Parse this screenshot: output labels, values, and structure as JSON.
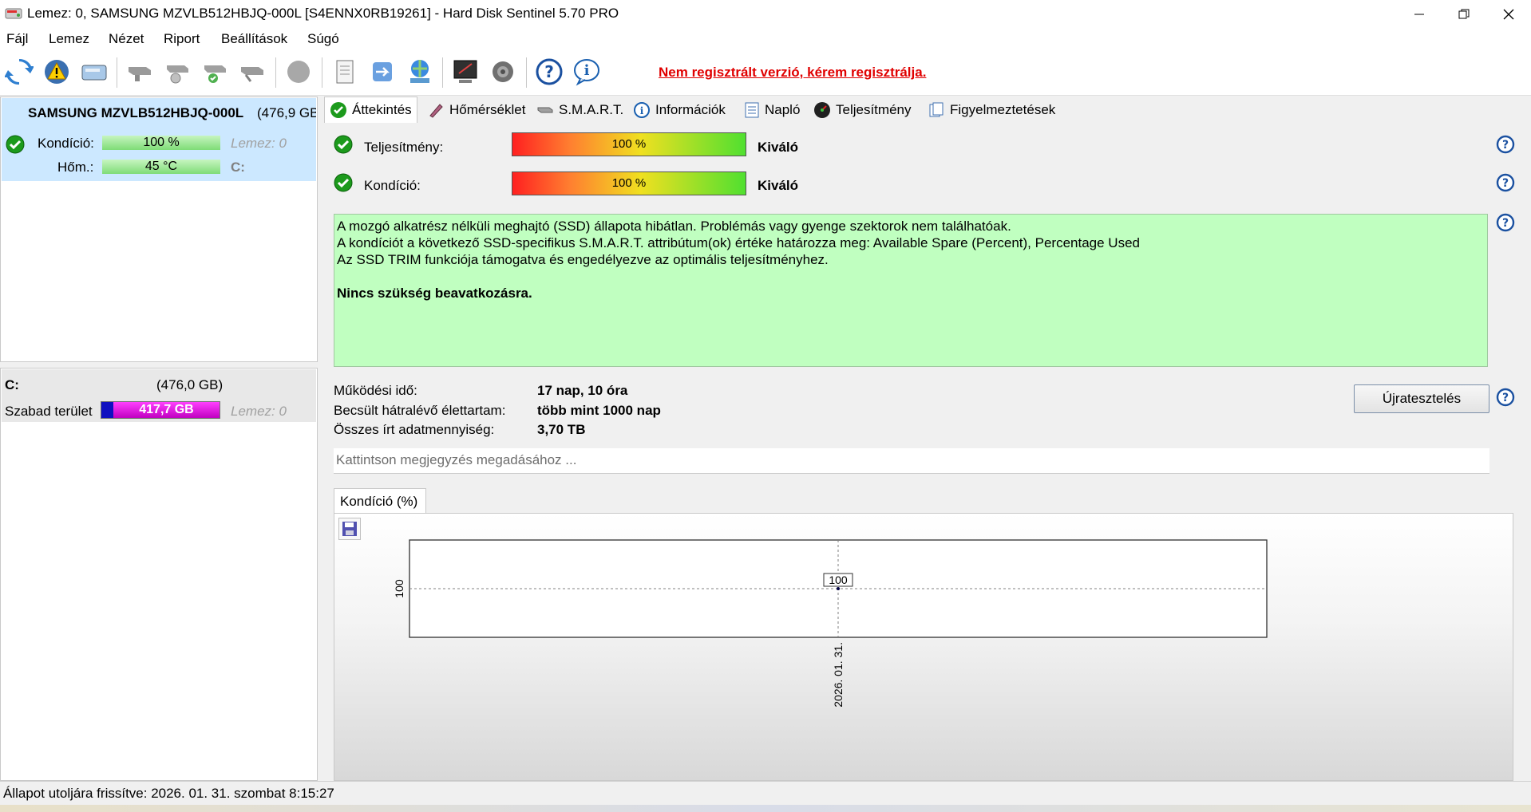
{
  "window": {
    "title": "Lemez: 0, SAMSUNG MZVLB512HBJQ-000L [S4ENNX0RB19261]  -  Hard Disk Sentinel 5.70 PRO"
  },
  "menu": [
    "Fájl",
    "Lemez",
    "Nézet",
    "Riport",
    "Beállítások",
    "Súgó"
  ],
  "toolbar": {
    "register_message": "Nem regisztrált verzió, kérem regisztrálja."
  },
  "disk": {
    "name": "SAMSUNG MZVLB512HBJQ-000L",
    "size": "(476,9 GB",
    "condition_label": "Kondíció:",
    "condition_value": "100 %",
    "condition_fraction": 1.0,
    "disk_label": "Lemez: 0",
    "temp_label": "Hőm.:",
    "temp_value": "45 °C",
    "temp_fraction": 1.0,
    "drive_letter": "C:"
  },
  "volume": {
    "letter": "C:",
    "size": "(476,0 GB)",
    "free_label": "Szabad terület",
    "free_value": "417,7 GB",
    "disk_label": "Lemez: 0"
  },
  "tabs": [
    "Áttekintés",
    "Hőmérséklet",
    "S.M.A.R.T.",
    "Információk",
    "Napló",
    "Teljesítmény",
    "Figyelmeztetések"
  ],
  "overview": {
    "performance_label": "Teljesítmény:",
    "performance_value": "100 %",
    "performance_fraction": 1.0,
    "performance_rating": "Kiváló",
    "condition_label": "Kondíció:",
    "condition_value": "100 %",
    "condition_fraction": 1.0,
    "condition_rating": "Kiváló",
    "description": [
      "A mozgó alkatrész nélküli meghajtó (SSD) állapota hibátlan. Problémás vagy gyenge szektorok nem találhatóak.",
      "A kondíciót a következő SSD-specifikus S.M.A.R.T. attribútum(ok) értéke határozza meg:  Available Spare (Percent), Percentage Used",
      "Az SSD TRIM funkciója támogatva és engedélyezve az optimális teljesítményhez."
    ],
    "recommendation": "Nincs szükség beavatkozásra.",
    "uptime_label": "Működési idő:",
    "uptime_value": "17 nap, 10 óra",
    "lifetime_label": "Becsült hátralévő élettartam:",
    "lifetime_value": "több mint 1000 nap",
    "written_label": "Összes írt adatmennyiség:",
    "written_value": "3,70 TB",
    "retest_button": "Újratesztelés",
    "note_placeholder": "Kattintson megjegyzés megadásához ..."
  },
  "chart_tab": "Kondíció  (%)",
  "chart_data": {
    "type": "line",
    "title": "",
    "x": [
      "2026. 01. 31."
    ],
    "series": [
      {
        "values": [
          100
        ]
      }
    ],
    "ytick": "100",
    "xtick": "2026. 01. 31.",
    "data_label": "100",
    "grid": true
  },
  "status": {
    "text": "Állapot utoljára frissítve: 2026. 01. 31. szombat 8:15:27"
  },
  "colors": {
    "selection": "#cce8ff",
    "register_red": "#e00000",
    "description_bg": "#c0ffc0",
    "free_space_bar": "#cc00cc"
  }
}
